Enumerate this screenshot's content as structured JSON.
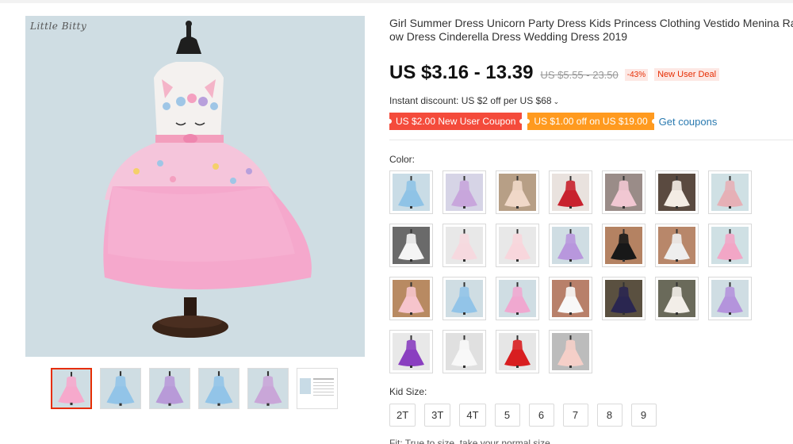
{
  "product": {
    "brand_watermark": "Little Bitty",
    "title_line1": "Girl Summer Dress Unicorn Party Dress Kids Princess Clothing Vestido Menina Rainb",
    "title_line2": "ow Dress Cinderella Dress Wedding Dress 2019"
  },
  "price": {
    "current": "US $3.16 - 13.39",
    "original": "US $5.55 - 23.50",
    "discount": "-43%",
    "new_user_deal": "New User Deal"
  },
  "instant_discount": {
    "text": "Instant discount: US $2 off per US $68",
    "chevron": "⌄"
  },
  "coupons": {
    "coupon1": "US $2.00 New User Coupon",
    "coupon2": "US $1.00 off on US $19.00",
    "get_coupons": "Get coupons"
  },
  "color": {
    "label": "Color:",
    "swatches": [
      {
        "bg": "#c9dce6",
        "dress": "#8fc3e6"
      },
      {
        "bg": "#d6d4e6",
        "dress": "#c8a6dc"
      },
      {
        "bg": "#b79f86",
        "dress": "#f0d8c8"
      },
      {
        "bg": "#e9e2de",
        "dress": "#c8222e"
      },
      {
        "bg": "#9a8c88",
        "dress": "#f1c7d2"
      },
      {
        "bg": "#5a4a40",
        "dress": "#f3ece4"
      },
      {
        "bg": "#cfe0e4",
        "dress": "#e6b0b6"
      },
      {
        "bg": "#6a6a6a",
        "dress": "#f5f5f5"
      },
      {
        "bg": "#e8e8e8",
        "dress": "#f6d9df"
      },
      {
        "bg": "#e8e8e8",
        "dress": "#f8d6dc"
      },
      {
        "bg": "#cfdde3",
        "dress": "#b897dd"
      },
      {
        "bg": "#b48262",
        "dress": "#181818"
      },
      {
        "bg": "#b8876a",
        "dress": "#eeeeee"
      },
      {
        "bg": "#cfe0e4",
        "dress": "#f2a6c6"
      },
      {
        "bg": "#b88a62",
        "dress": "#f6c4cc"
      },
      {
        "bg": "#cfdde3",
        "dress": "#92c4e8"
      },
      {
        "bg": "#cfdde3",
        "dress": "#f0a8d0"
      },
      {
        "bg": "#b8806a",
        "dress": "#f8f8f8"
      },
      {
        "bg": "#5a5040",
        "dress": "#2a2650"
      },
      {
        "bg": "#6a6a5a",
        "dress": "#f2eee8"
      },
      {
        "bg": "#cfdde3",
        "dress": "#b494dc"
      },
      {
        "bg": "#e8e8e8",
        "dress": "#8a3fc0"
      },
      {
        "bg": "#e0e0e0",
        "dress": "#f8f8f8"
      },
      {
        "bg": "#e6e6e6",
        "dress": "#d81e20"
      },
      {
        "bg": "#bcbcbc",
        "dress": "#f5cfc8"
      }
    ]
  },
  "size": {
    "label": "Kid Size:",
    "options": [
      "2T",
      "3T",
      "4T",
      "5",
      "6",
      "7",
      "8",
      "9"
    ]
  },
  "thumbnails": [
    {
      "dress": "#f6a9cc"
    },
    {
      "dress": "#92c4e8"
    },
    {
      "dress": "#b89ad8"
    },
    {
      "dress": "#92c4e8"
    },
    {
      "dress": "#c9a6d8"
    },
    {
      "dress": "chart"
    }
  ],
  "cut_text": "Fit: True to size, take your normal size"
}
